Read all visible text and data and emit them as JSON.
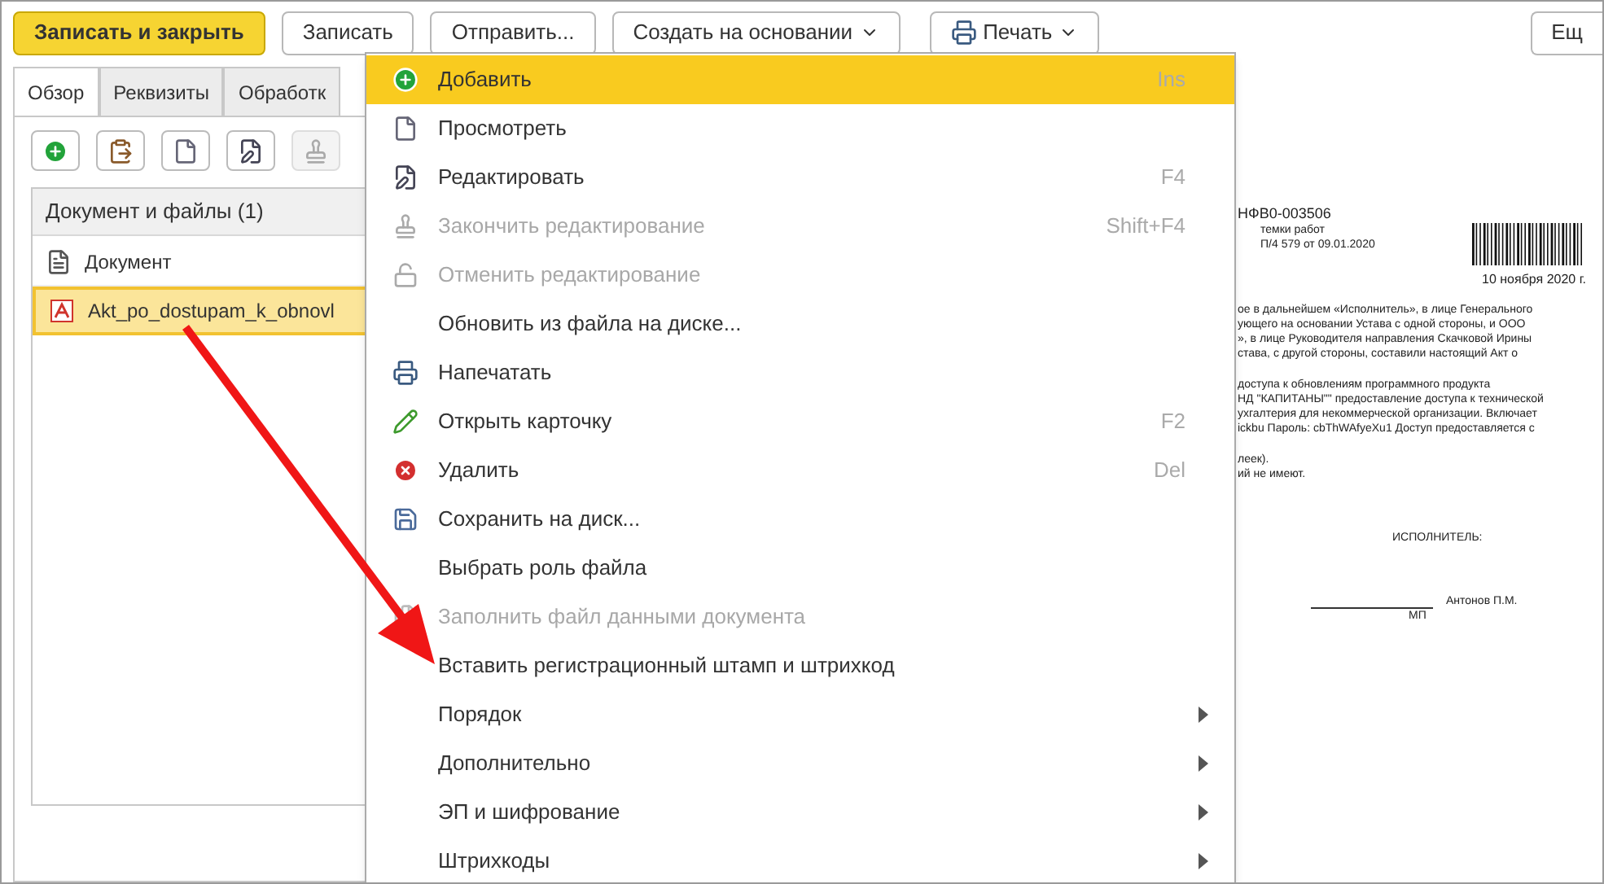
{
  "toolbar": {
    "buttons": [
      {
        "label": "Записать и закрыть",
        "kind": "primary"
      },
      {
        "label": "Записать",
        "kind": "plain"
      },
      {
        "label": "Отправить...",
        "kind": "plain"
      },
      {
        "label": "Создать на основании",
        "kind": "dropdown"
      },
      {
        "label": "Печать",
        "kind": "print"
      },
      {
        "label": "Ещ",
        "kind": "plain"
      }
    ]
  },
  "tabs": [
    {
      "label": "Обзор",
      "selected": true
    },
    {
      "label": "Реквизиты",
      "selected": false
    },
    {
      "label": "Обработк",
      "selected": false
    }
  ],
  "file_toolbar": [
    {
      "disabled": false
    },
    {
      "disabled": false
    },
    {
      "disabled": false
    },
    {
      "disabled": false
    },
    {
      "disabled": true
    }
  ],
  "file_list": {
    "header": "Документ и файлы (1)",
    "rows": [
      {
        "name": "Документ",
        "selected": false
      },
      {
        "name": "Akt_po_dostupam_k_obnovl",
        "selected": true
      }
    ]
  },
  "context_menu": [
    {
      "label": "Добавить",
      "shortcut": "Ins",
      "disabled": false,
      "selected": true,
      "submenu": false
    },
    {
      "label": "Просмотреть",
      "disabled": false,
      "selected": false,
      "submenu": false
    },
    {
      "label": "Редактировать",
      "shortcut": "F4",
      "disabled": false,
      "selected": false,
      "submenu": false
    },
    {
      "label": "Закончить редактирование",
      "shortcut": "Shift+F4",
      "disabled": true,
      "selected": false,
      "submenu": false
    },
    {
      "label": "Отменить редактирование",
      "disabled": true,
      "selected": false,
      "submenu": false
    },
    {
      "label": "Обновить из файла на диске...",
      "disabled": false,
      "selected": false,
      "submenu": false
    },
    {
      "label": "Напечатать",
      "disabled": false,
      "selected": false,
      "submenu": false
    },
    {
      "label": "Открыть карточку",
      "shortcut": "F2",
      "disabled": false,
      "selected": false,
      "submenu": false
    },
    {
      "label": "Удалить",
      "shortcut": "Del",
      "disabled": false,
      "selected": false,
      "submenu": false
    },
    {
      "label": "Сохранить на диск...",
      "disabled": false,
      "selected": false,
      "submenu": false
    },
    {
      "label": "Выбрать роль файла",
      "disabled": false,
      "selected": false,
      "submenu": false
    },
    {
      "label": "Заполнить файл данными документа",
      "disabled": true,
      "selected": false,
      "submenu": false
    },
    {
      "label": "Вставить регистрационный штамп и штрихкод",
      "disabled": false,
      "selected": false,
      "submenu": false
    },
    {
      "label": "Порядок",
      "disabled": false,
      "selected": false,
      "submenu": true
    },
    {
      "label": "Дополнительно",
      "disabled": false,
      "selected": false,
      "submenu": true
    },
    {
      "label": "ЭП и шифрование",
      "disabled": false,
      "selected": false,
      "submenu": true
    },
    {
      "label": "Штрихкоды",
      "disabled": false,
      "selected": false,
      "submenu": true
    }
  ],
  "preview": {
    "number": "НФВ0-003506",
    "subtitle": "темки работ",
    "reference": "П/4 579 от 09.01.2020",
    "date": "10 ноября 2020 г.",
    "paragraphs": [
      [
        "ое в дальнейшем «Исполнитель», в лице Генерального",
        "ующего на основании Устава с одной стороны, и ООО",
        "», в лице Руководителя направления Скачковой Ирины",
        "става, с другой стороны, составили настоящий Акт о"
      ],
      [
        "доступа к обновлениям программного продукта",
        "НД \"КАПИТАНЫ\"\" предоставление доступа к технической",
        "ухгалтерия для некоммерческой организации. Включает",
        "ickbu Пароль: cbThWAfyeXu1 Доступ предоставляется с"
      ],
      [
        "леек).",
        "ий не имеют."
      ]
    ],
    "signature_title": "ИСПОЛНИТЕЛЬ:",
    "signer": "Антонов П.М.",
    "stamp_place": "МП"
  }
}
